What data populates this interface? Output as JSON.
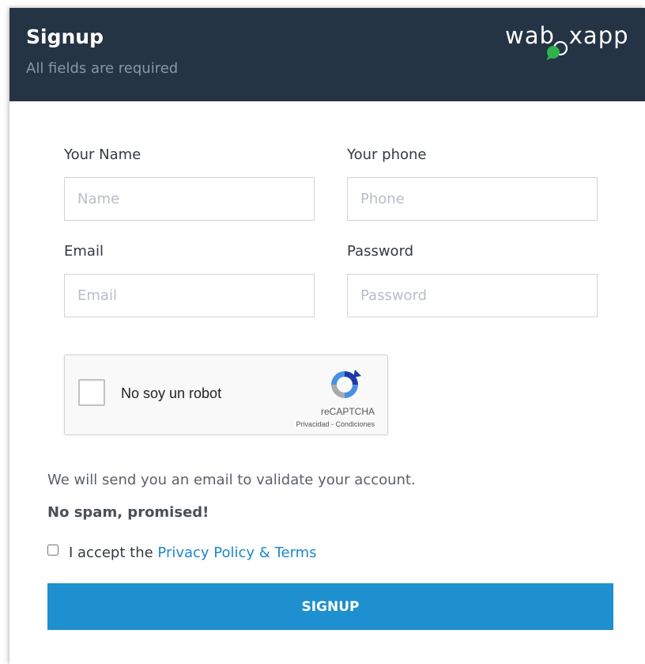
{
  "header": {
    "title": "Signup",
    "subtitle": "All fields are required",
    "logo_text_left": "wab",
    "logo_text_right": "xapp",
    "logo_letters_hidden": "o",
    "colors": {
      "background": "#243445",
      "logo_bubble": "#2fb24c"
    }
  },
  "form": {
    "name": {
      "label": "Your Name",
      "placeholder": "Name",
      "value": ""
    },
    "phone": {
      "label": "Your phone",
      "placeholder": "Phone",
      "value": ""
    },
    "email": {
      "label": "Email",
      "placeholder": "Email",
      "value": ""
    },
    "password": {
      "label": "Password",
      "placeholder": "Password",
      "value": ""
    }
  },
  "captcha": {
    "label": "No soy un robot",
    "brand": "reCAPTCHA",
    "privacy": "Privacidad",
    "separator": " - ",
    "terms": "Condiciones",
    "checked": false,
    "icon": "recaptcha-logo-icon"
  },
  "info": {
    "email_notice": "We will send you an email to validate your account.",
    "no_spam": "No spam, promised!"
  },
  "terms": {
    "prefix": "I accept the ",
    "link": "Privacy Policy & Terms",
    "checked": false,
    "link_color": "#1e88c7"
  },
  "submit": {
    "label": "SIGNUP",
    "color": "#1e8fcf"
  }
}
